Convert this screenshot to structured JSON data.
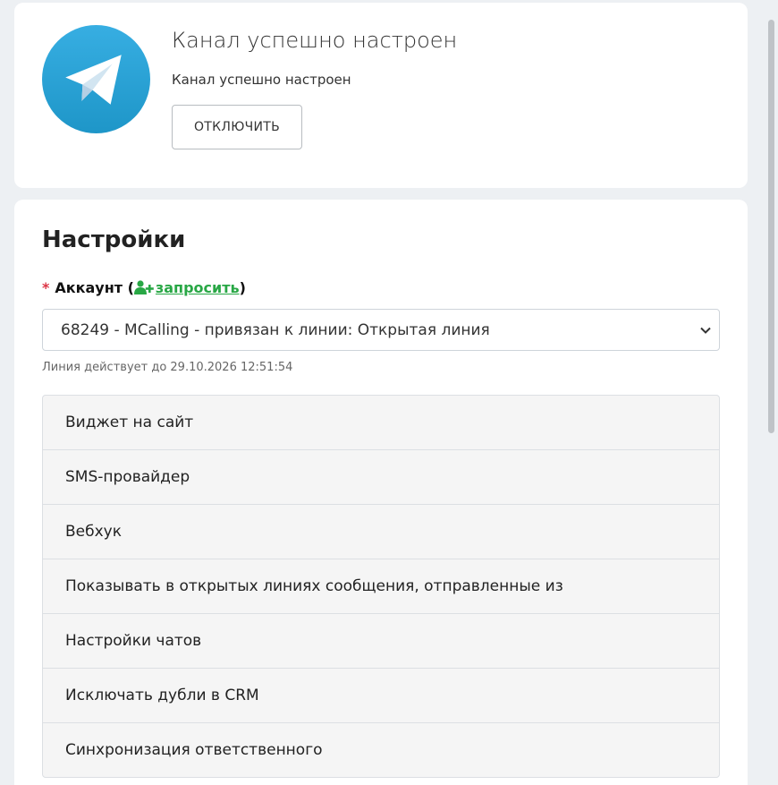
{
  "status": {
    "title": "Канал успешно настроен",
    "subtitle": "Канал успешно настроен",
    "disconnect_label": "ОТКЛЮЧИТЬ"
  },
  "settings": {
    "title": "Настройки",
    "account_required_mark": "*",
    "account_label": "Аккаунт (",
    "request_link": "запросить",
    "account_label_end": ")",
    "account_selected": "68249 - MCalling - привязан к линии: Открытая линия",
    "line_hint": "Линия действует до 29.10.2026 12:51:54",
    "items": [
      "Виджет на сайт",
      "SMS-провайдер",
      "Вебхук",
      "Показывать в открытых линиях сообщения, отправленные из",
      "Настройки чатов",
      "Исключать дубли в CRM",
      "Синхронизация ответственного"
    ]
  },
  "icons": {
    "logo": "telegram-logo",
    "user_plus": "user-plus-icon",
    "select_chevron": "chevron-down-icon"
  },
  "colors": {
    "telegram_blue": "#2aa3df",
    "link_green": "#28a745",
    "required_red": "#dc3545"
  }
}
